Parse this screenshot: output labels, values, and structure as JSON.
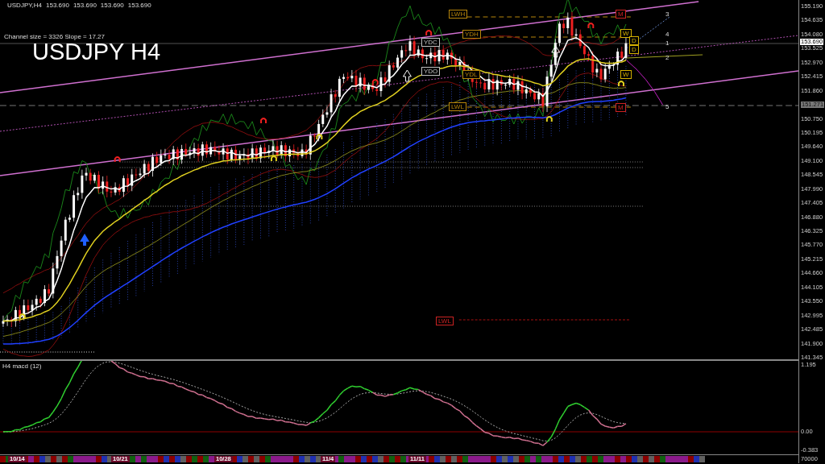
{
  "header": {
    "symbol": "USDJPY,H4",
    "prices": [
      "153.690",
      "153.690",
      "153.690",
      "153.690"
    ]
  },
  "channel_info": "Channel size = 3326 Slope = 17.27",
  "symbol_label": "USDJPY H4",
  "level_labels": [
    {
      "text": "LWH",
      "color": "#b8860b"
    },
    {
      "text": "YDH",
      "color": "#b8860b"
    },
    {
      "text": "YDC",
      "color": "#c0c0c0"
    },
    {
      "text": "YDO",
      "color": "#c0c0c0"
    },
    {
      "text": "YDL",
      "color": "#b8860b"
    },
    {
      "text": "LWL",
      "color": "#b8860b"
    },
    {
      "text": "LWL",
      "color": "#cc2222"
    },
    {
      "text": "M",
      "color": "#cc2222"
    },
    {
      "text": "W",
      "color": "#d4b000"
    },
    {
      "text": "D",
      "color": "#d4b000"
    },
    {
      "text": "D",
      "color": "#d4b000"
    },
    {
      "text": "W",
      "color": "#d4b000"
    },
    {
      "text": "M",
      "color": "#cc2222"
    }
  ],
  "channel_numbers": [
    "3",
    "4",
    "1",
    "2",
    "5"
  ],
  "price_axis": {
    "ticks": [
      "155.190",
      "154.635",
      "154.080",
      "153.525",
      "152.970",
      "152.415",
      "151.860",
      "151.271",
      "150.750",
      "150.195",
      "149.640",
      "149.100",
      "148.545",
      "147.990",
      "147.405",
      "146.880",
      "146.325",
      "145.770",
      "145.215",
      "144.660",
      "144.105",
      "143.550",
      "142.995",
      "142.485",
      "141.900",
      "141.345"
    ],
    "current_price": "153.690"
  },
  "macd": {
    "title": "H4  macd (12)",
    "axis": [
      "1.195",
      "0.00",
      "-0.383"
    ]
  },
  "volume_axis": "70000",
  "dates": [
    "10/14",
    "10/21",
    "10/28",
    "11/4",
    "11/11"
  ]
}
